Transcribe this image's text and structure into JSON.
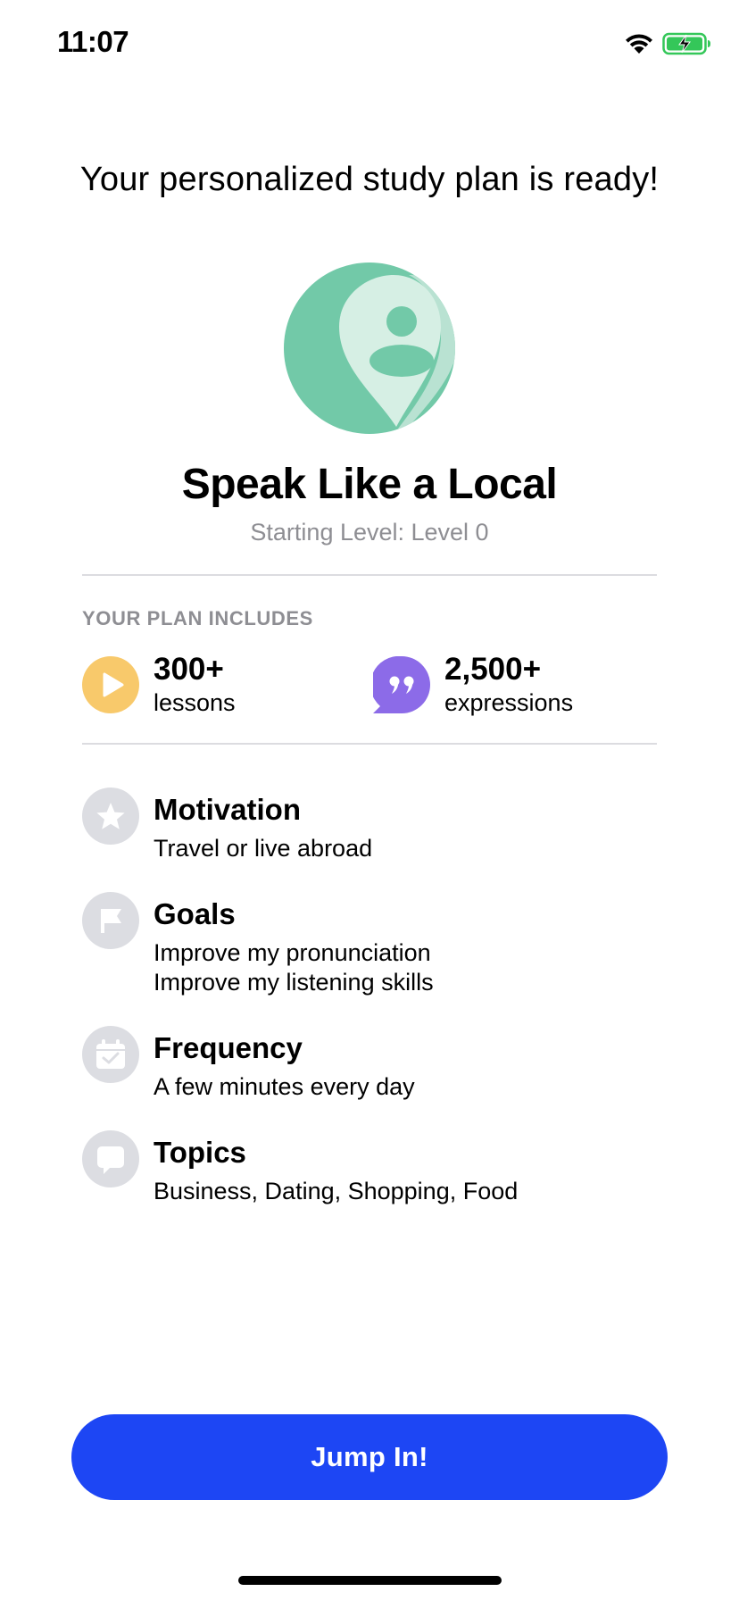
{
  "status_bar": {
    "time": "11:07",
    "wifi_icon": "wifi-icon",
    "battery_icon": "battery-charging-icon",
    "battery_color": "#34c759"
  },
  "headline": "Your personalized study plan is ready!",
  "plan": {
    "icon": "location-person-icon",
    "title": "Speak Like a Local",
    "starting_level": "Starting Level: Level 0"
  },
  "includes": {
    "label": "YOUR PLAN INCLUDES",
    "stats": [
      {
        "number": "300+",
        "label": "lessons",
        "icon": "play-icon",
        "color": "#f8c96b"
      },
      {
        "number": "2,500+",
        "label": "expressions",
        "icon": "quote-bubble-icon",
        "color": "#8c6be8"
      }
    ]
  },
  "details": [
    {
      "icon": "star-icon",
      "title": "Motivation",
      "lines": [
        "Travel or live abroad"
      ]
    },
    {
      "icon": "flag-icon",
      "title": "Goals",
      "lines": [
        "Improve my pronunciation",
        "Improve my listening skills"
      ]
    },
    {
      "icon": "calendar-check-icon",
      "title": "Frequency",
      "lines": [
        "A few minutes every day"
      ]
    },
    {
      "icon": "chat-bubble-icon",
      "title": "Topics",
      "lines": [
        "Business, Dating, Shopping, Food"
      ]
    }
  ],
  "button": {
    "label": "Jump In!",
    "color": "#1d46f4"
  },
  "colors": {
    "accent_green": "#72c9a8",
    "icon_gray_bg": "#dcdde2",
    "secondary_text": "#8e8e93"
  }
}
